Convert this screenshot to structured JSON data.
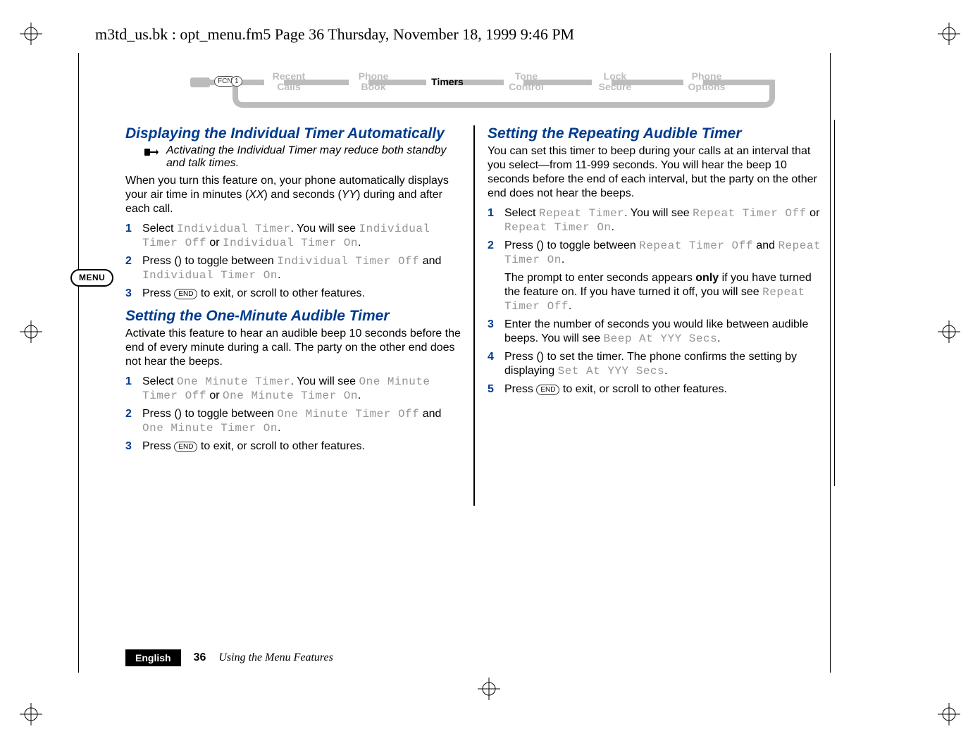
{
  "runhead": "m3td_us.bk : opt_menu.fm5  Page 36  Thursday, November 18, 1999  9:46 PM",
  "crumb": {
    "keys": [
      "FCN",
      "1"
    ],
    "items": [
      {
        "label": "Recent\nCalls",
        "active": false
      },
      {
        "label": "Phone\nBook",
        "active": false
      },
      {
        "label": "Timers",
        "active": true,
        "single": true
      },
      {
        "label": "Tone\nControl",
        "active": false
      },
      {
        "label": "Lock\nSecure",
        "active": false
      },
      {
        "label": "Phone\nOptions",
        "active": false
      }
    ]
  },
  "left": {
    "h1": "Displaying the Individual Timer Automatically",
    "note": "Activating the Individual Timer may reduce both standby and talk times.",
    "p1a": "When you turn this feature on, your phone automatically displays your air time in minutes (",
    "p1_xx": "XX",
    "p1b": ") and seconds (",
    "p1_yy": "YY",
    "p1c": ") during and after each call.",
    "steps1": {
      "s1a": "Select ",
      "s1_lcd1": "Individual Timer",
      "s1b": ". You will see ",
      "s1_lcd2": "Individual Timer Off",
      "s1c": " or ",
      "s1_lcd3": "Individual Timer On",
      "s1d": ".",
      "s2a": "Press () to toggle between ",
      "s2_lcd1": "Individual Timer Off",
      "s2b": " and ",
      "s2_lcd2": "Individual Timer On",
      "s2c": ".",
      "s3a": "Press ",
      "s3_key": "END",
      "s3b": " to exit, or scroll to other features."
    },
    "h2": "Setting the One-Minute Audible Timer",
    "p2": "Activate this feature to hear an audible beep 10 seconds before the end of every minute during a call. The party on the other end does not hear the beeps.",
    "steps2": {
      "s1a": "Select ",
      "s1_lcd1": "One Minute Timer",
      "s1b": ". You will see ",
      "s1_lcd2": "One Minute Timer Off",
      "s1c": " or ",
      "s1_lcd3": "One Minute Timer On",
      "s1d": ".",
      "s2a": "Press () to toggle between ",
      "s2_lcd1": "One Minute Timer Off",
      "s2b": " and ",
      "s2_lcd2": "One Minute Timer On",
      "s2c": ".",
      "s3a": "Press ",
      "s3_key": "END",
      "s3b": " to exit, or scroll to other features."
    }
  },
  "right": {
    "h1": "Setting the Repeating Audible Timer",
    "p1": "You can set this timer to beep during your calls at an interval that you select—from 11-999 seconds. You will hear the beep 10 seconds before the end of each interval, but the party on the other end does not hear the beeps.",
    "steps": {
      "s1a": "Select ",
      "s1_lcd1": "Repeat Timer",
      "s1b": ". You will see ",
      "s1_lcd2": "Repeat Timer Off",
      "s1c": " or ",
      "s1_lcd3": "Repeat Timer On",
      "s1d": ".",
      "s2a": "Press () to toggle between ",
      "s2_lcd1": "Repeat Timer Off",
      "s2b": " and ",
      "s2_lcd2": "Repeat Timer On",
      "s2c": ".",
      "s2_note_a": "The prompt to enter seconds appears ",
      "s2_note_bold": "only",
      "s2_note_b": " if you have turned the feature on. If you have turned it off, you will see ",
      "s2_note_lcd": "Repeat Timer Off",
      "s2_note_c": ".",
      "s3a": "Enter the number of seconds you would like between audible beeps. You will see ",
      "s3_lcd": "Beep At YYY Secs",
      "s3b": ".",
      "s4a": "Press () to set the timer. The phone confirms the setting by displaying ",
      "s4_lcd": "Set At YYY Secs",
      "s4b": ".",
      "s5a": "Press ",
      "s5_key": "END",
      "s5b": " to exit, or scroll to other features."
    }
  },
  "gutter": {
    "menu": "MENU"
  },
  "footer": {
    "lang": "English",
    "page": "36",
    "title": "Using the Menu Features"
  }
}
